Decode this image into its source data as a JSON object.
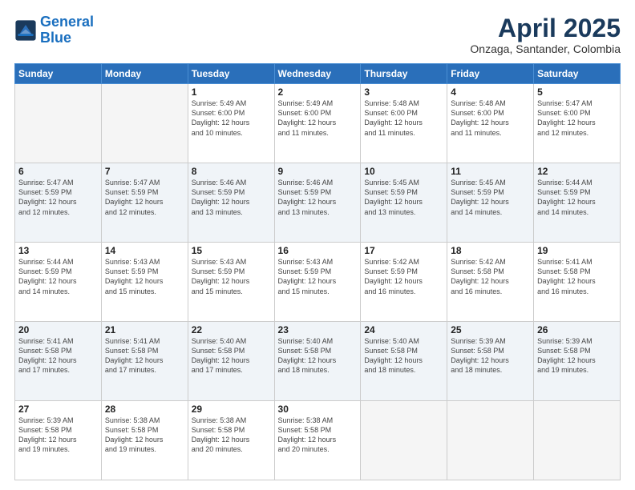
{
  "logo": {
    "line1": "General",
    "line2": "Blue"
  },
  "header": {
    "month": "April 2025",
    "location": "Onzaga, Santander, Colombia"
  },
  "weekdays": [
    "Sunday",
    "Monday",
    "Tuesday",
    "Wednesday",
    "Thursday",
    "Friday",
    "Saturday"
  ],
  "weeks": [
    [
      {
        "day": "",
        "info": ""
      },
      {
        "day": "",
        "info": ""
      },
      {
        "day": "1",
        "info": "Sunrise: 5:49 AM\nSunset: 6:00 PM\nDaylight: 12 hours\nand 10 minutes."
      },
      {
        "day": "2",
        "info": "Sunrise: 5:49 AM\nSunset: 6:00 PM\nDaylight: 12 hours\nand 11 minutes."
      },
      {
        "day": "3",
        "info": "Sunrise: 5:48 AM\nSunset: 6:00 PM\nDaylight: 12 hours\nand 11 minutes."
      },
      {
        "day": "4",
        "info": "Sunrise: 5:48 AM\nSunset: 6:00 PM\nDaylight: 12 hours\nand 11 minutes."
      },
      {
        "day": "5",
        "info": "Sunrise: 5:47 AM\nSunset: 6:00 PM\nDaylight: 12 hours\nand 12 minutes."
      }
    ],
    [
      {
        "day": "6",
        "info": "Sunrise: 5:47 AM\nSunset: 5:59 PM\nDaylight: 12 hours\nand 12 minutes."
      },
      {
        "day": "7",
        "info": "Sunrise: 5:47 AM\nSunset: 5:59 PM\nDaylight: 12 hours\nand 12 minutes."
      },
      {
        "day": "8",
        "info": "Sunrise: 5:46 AM\nSunset: 5:59 PM\nDaylight: 12 hours\nand 13 minutes."
      },
      {
        "day": "9",
        "info": "Sunrise: 5:46 AM\nSunset: 5:59 PM\nDaylight: 12 hours\nand 13 minutes."
      },
      {
        "day": "10",
        "info": "Sunrise: 5:45 AM\nSunset: 5:59 PM\nDaylight: 12 hours\nand 13 minutes."
      },
      {
        "day": "11",
        "info": "Sunrise: 5:45 AM\nSunset: 5:59 PM\nDaylight: 12 hours\nand 14 minutes."
      },
      {
        "day": "12",
        "info": "Sunrise: 5:44 AM\nSunset: 5:59 PM\nDaylight: 12 hours\nand 14 minutes."
      }
    ],
    [
      {
        "day": "13",
        "info": "Sunrise: 5:44 AM\nSunset: 5:59 PM\nDaylight: 12 hours\nand 14 minutes."
      },
      {
        "day": "14",
        "info": "Sunrise: 5:43 AM\nSunset: 5:59 PM\nDaylight: 12 hours\nand 15 minutes."
      },
      {
        "day": "15",
        "info": "Sunrise: 5:43 AM\nSunset: 5:59 PM\nDaylight: 12 hours\nand 15 minutes."
      },
      {
        "day": "16",
        "info": "Sunrise: 5:43 AM\nSunset: 5:59 PM\nDaylight: 12 hours\nand 15 minutes."
      },
      {
        "day": "17",
        "info": "Sunrise: 5:42 AM\nSunset: 5:59 PM\nDaylight: 12 hours\nand 16 minutes."
      },
      {
        "day": "18",
        "info": "Sunrise: 5:42 AM\nSunset: 5:58 PM\nDaylight: 12 hours\nand 16 minutes."
      },
      {
        "day": "19",
        "info": "Sunrise: 5:41 AM\nSunset: 5:58 PM\nDaylight: 12 hours\nand 16 minutes."
      }
    ],
    [
      {
        "day": "20",
        "info": "Sunrise: 5:41 AM\nSunset: 5:58 PM\nDaylight: 12 hours\nand 17 minutes."
      },
      {
        "day": "21",
        "info": "Sunrise: 5:41 AM\nSunset: 5:58 PM\nDaylight: 12 hours\nand 17 minutes."
      },
      {
        "day": "22",
        "info": "Sunrise: 5:40 AM\nSunset: 5:58 PM\nDaylight: 12 hours\nand 17 minutes."
      },
      {
        "day": "23",
        "info": "Sunrise: 5:40 AM\nSunset: 5:58 PM\nDaylight: 12 hours\nand 18 minutes."
      },
      {
        "day": "24",
        "info": "Sunrise: 5:40 AM\nSunset: 5:58 PM\nDaylight: 12 hours\nand 18 minutes."
      },
      {
        "day": "25",
        "info": "Sunrise: 5:39 AM\nSunset: 5:58 PM\nDaylight: 12 hours\nand 18 minutes."
      },
      {
        "day": "26",
        "info": "Sunrise: 5:39 AM\nSunset: 5:58 PM\nDaylight: 12 hours\nand 19 minutes."
      }
    ],
    [
      {
        "day": "27",
        "info": "Sunrise: 5:39 AM\nSunset: 5:58 PM\nDaylight: 12 hours\nand 19 minutes."
      },
      {
        "day": "28",
        "info": "Sunrise: 5:38 AM\nSunset: 5:58 PM\nDaylight: 12 hours\nand 19 minutes."
      },
      {
        "day": "29",
        "info": "Sunrise: 5:38 AM\nSunset: 5:58 PM\nDaylight: 12 hours\nand 20 minutes."
      },
      {
        "day": "30",
        "info": "Sunrise: 5:38 AM\nSunset: 5:58 PM\nDaylight: 12 hours\nand 20 minutes."
      },
      {
        "day": "",
        "info": ""
      },
      {
        "day": "",
        "info": ""
      },
      {
        "day": "",
        "info": ""
      }
    ]
  ]
}
